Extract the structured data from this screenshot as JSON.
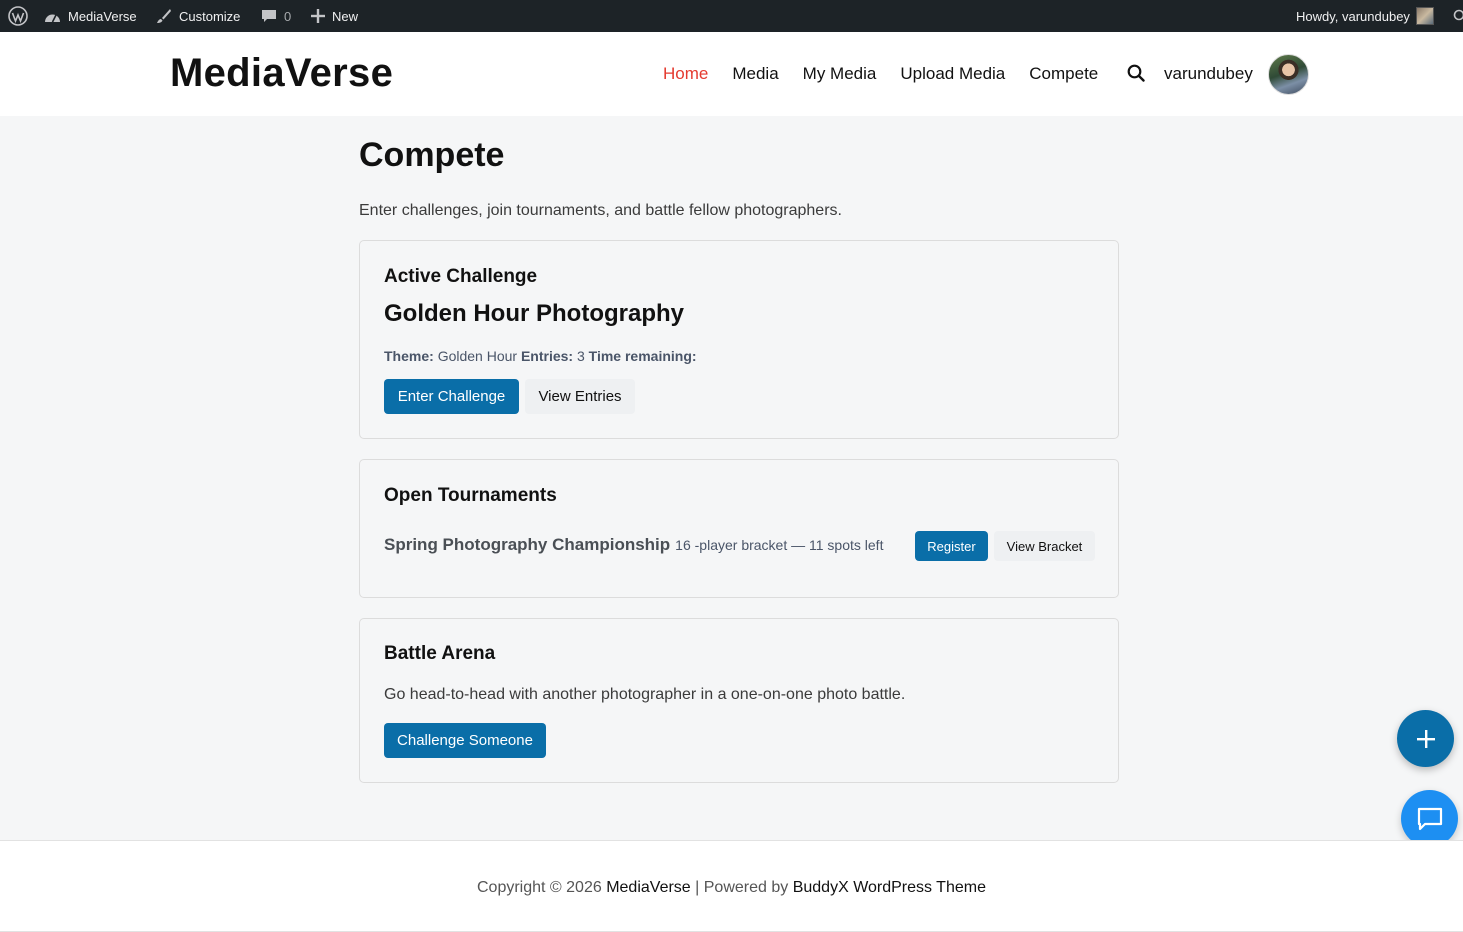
{
  "adminbar": {
    "site_name": "MediaVerse",
    "customize": "Customize",
    "comments_count": "0",
    "new": "New",
    "howdy": "Howdy, varundubey"
  },
  "header": {
    "logo": "MediaVerse",
    "nav": [
      "Home",
      "Media",
      "My Media",
      "Upload Media",
      "Compete"
    ],
    "active_nav": "Home",
    "username": "varundubey"
  },
  "page": {
    "title": "Compete",
    "description": "Enter challenges, join tournaments, and battle fellow photographers."
  },
  "active_challenge": {
    "heading": "Active Challenge",
    "name": "Golden Hour Photography",
    "theme_label": "Theme:",
    "theme_value": "Golden Hour",
    "entries_label": "Entries:",
    "entries_value": "3",
    "time_label": "Time remaining:",
    "enter_button": "Enter Challenge",
    "view_button": "View Entries"
  },
  "tournaments": {
    "heading": "Open Tournaments",
    "items": [
      {
        "name": "Spring Photography Championship",
        "info": "16 -player bracket — 11 spots left",
        "register": "Register",
        "view_bracket": "View Bracket"
      }
    ]
  },
  "battle": {
    "heading": "Battle Arena",
    "description": "Go head-to-head with another photographer in a one-on-one photo battle.",
    "button": "Challenge Someone"
  },
  "footer": {
    "prefix": "Copyright © 2026",
    "site_link": "MediaVerse",
    "separator": "| Powered by",
    "theme_link": "BuddyX WordPress Theme"
  },
  "colors": {
    "accent": "#0a6ea8",
    "nav_active": "#e43a2f",
    "admin_bar": "#1d2327"
  }
}
